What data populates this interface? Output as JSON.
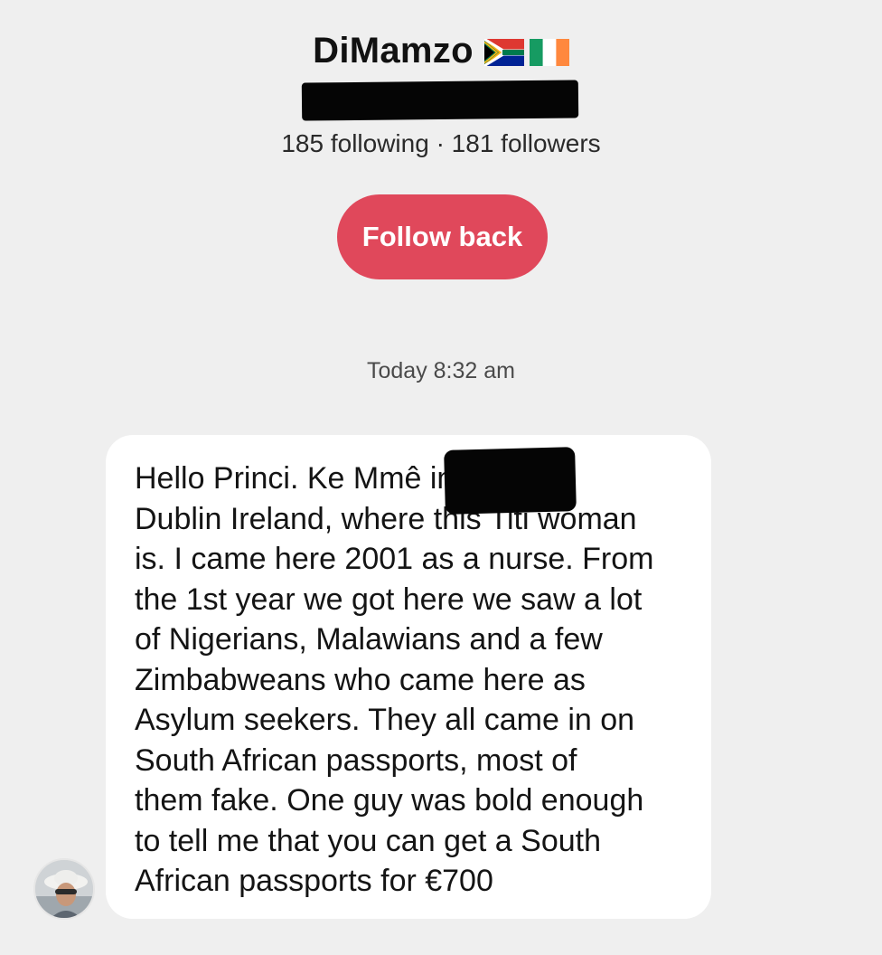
{
  "profile": {
    "display_name": "DiMamzo",
    "flags": [
      "south-africa-flag-icon",
      "ireland-flag-icon"
    ],
    "follow_counts": "185 following · 181 followers",
    "follow_button_label": "Follow back"
  },
  "conversation": {
    "timestamp": "Today 8:32 am",
    "message": {
      "text": "Hello Princi. Ke Mmê                       in\nDublin Ireland, where this Titi woman\nis. I came here 2001 as a nurse. From\nthe 1st year we got here we saw a lot\nof Nigerians, Malawians and a few\nZimbabweans who came here as\nAsylum seekers. They all came in on\nSouth African passports, most of\nthem fake. One guy was bold enough\nto tell me that you can get a South\nAfrican passports for €700",
      "sender_avatar": "avatar"
    }
  },
  "colors": {
    "background": "#efefef",
    "follow_button": "#e0485b",
    "bubble": "#ffffff",
    "redaction": "#050505"
  }
}
